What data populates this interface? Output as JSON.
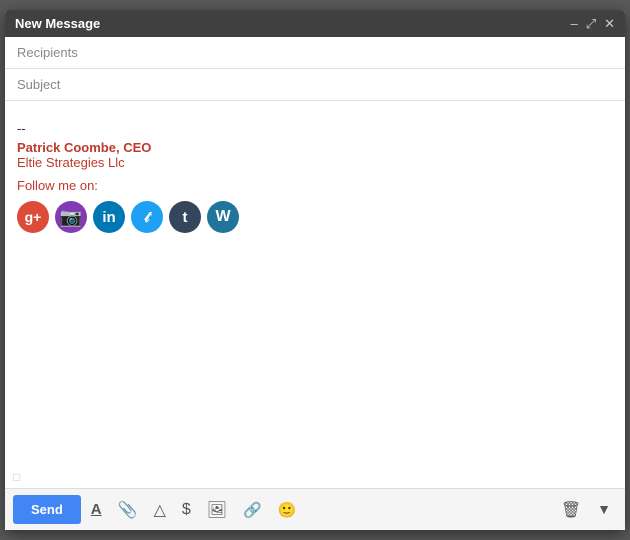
{
  "window": {
    "title": "New Message",
    "minimize_label": "–",
    "expand_label": "⤢",
    "close_label": "✕"
  },
  "fields": {
    "recipients_placeholder": "Recipients",
    "subject_placeholder": "Subject"
  },
  "signature": {
    "dash": "--",
    "name": "Patrick Coombe, CEO",
    "company": "Eltie Strategies Llc",
    "follow": "Follow me on:"
  },
  "social": [
    {
      "id": "gplus",
      "label": "g+",
      "class": "icon-gplus",
      "name": "google-plus-icon"
    },
    {
      "id": "instagram",
      "label": "📷",
      "class": "icon-instagram",
      "name": "instagram-icon"
    },
    {
      "id": "linkedin",
      "label": "in",
      "class": "icon-linkedin",
      "name": "linkedin-icon"
    },
    {
      "id": "twitter",
      "label": "t",
      "class": "icon-twitter",
      "name": "twitter-icon"
    },
    {
      "id": "tumblr",
      "label": "t",
      "class": "icon-tumblr",
      "name": "tumblr-icon"
    },
    {
      "id": "wordpress",
      "label": "W",
      "class": "icon-wordpress",
      "name": "wordpress-icon"
    }
  ],
  "toolbar": {
    "send_label": "Send",
    "format_tooltip": "Formatting options",
    "attach_tooltip": "Attach files",
    "drive_tooltip": "Insert files using Drive",
    "money_tooltip": "Insert money",
    "photo_tooltip": "Insert photo",
    "link_tooltip": "Insert link",
    "emoji_tooltip": "Insert emoji",
    "delete_tooltip": "Delete",
    "more_tooltip": "More options"
  }
}
